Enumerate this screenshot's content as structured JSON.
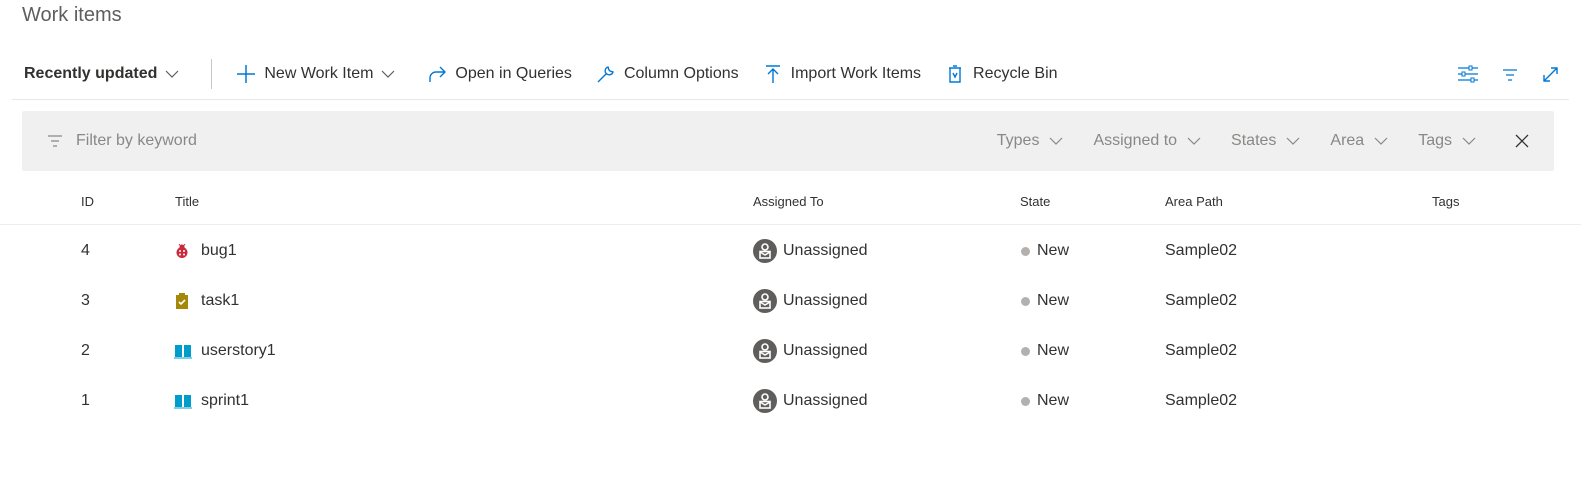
{
  "page": {
    "title": "Work items"
  },
  "toolbar": {
    "view": "Recently updated",
    "new_item": "New Work Item",
    "open_queries": "Open in Queries",
    "column_options": "Column Options",
    "import": "Import Work Items",
    "recycle": "Recycle Bin"
  },
  "filter": {
    "placeholder": "Filter by keyword",
    "types": "Types",
    "assigned": "Assigned to",
    "states": "States",
    "area": "Area",
    "tags": "Tags"
  },
  "columns": {
    "id": "ID",
    "title": "Title",
    "assigned": "Assigned To",
    "state": "State",
    "area": "Area Path",
    "tags": "Tags"
  },
  "rows": [
    {
      "id": "4",
      "type": "bug",
      "title": "bug1",
      "assigned": "Unassigned",
      "state": "New",
      "area": "Sample02"
    },
    {
      "id": "3",
      "type": "task",
      "title": "task1",
      "assigned": "Unassigned",
      "state": "New",
      "area": "Sample02"
    },
    {
      "id": "2",
      "type": "user-story",
      "title": "userstory1",
      "assigned": "Unassigned",
      "state": "New",
      "area": "Sample02"
    },
    {
      "id": "1",
      "type": "user-story",
      "title": "sprint1",
      "assigned": "Unassigned",
      "state": "New",
      "area": "Sample02"
    }
  ],
  "colors": {
    "accent": "#0078d4",
    "bug": "#cc293d",
    "task": "#a4880a",
    "story": "#009ccc"
  }
}
